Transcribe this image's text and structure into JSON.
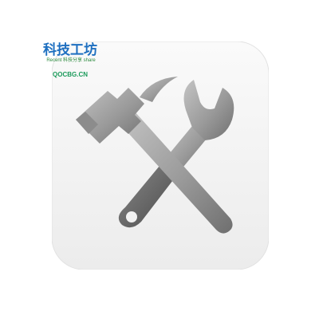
{
  "watermark": {
    "title": "科技工坊",
    "subtitle": "Recent 科技分享 share",
    "url": "QOCBG.CN"
  },
  "icon": {
    "name": "hammer-and-wrench-icon",
    "colors": {
      "tile_background": "#f3f3f3",
      "tool_light": "#a6a6a6",
      "tool_dark": "#595959"
    }
  }
}
